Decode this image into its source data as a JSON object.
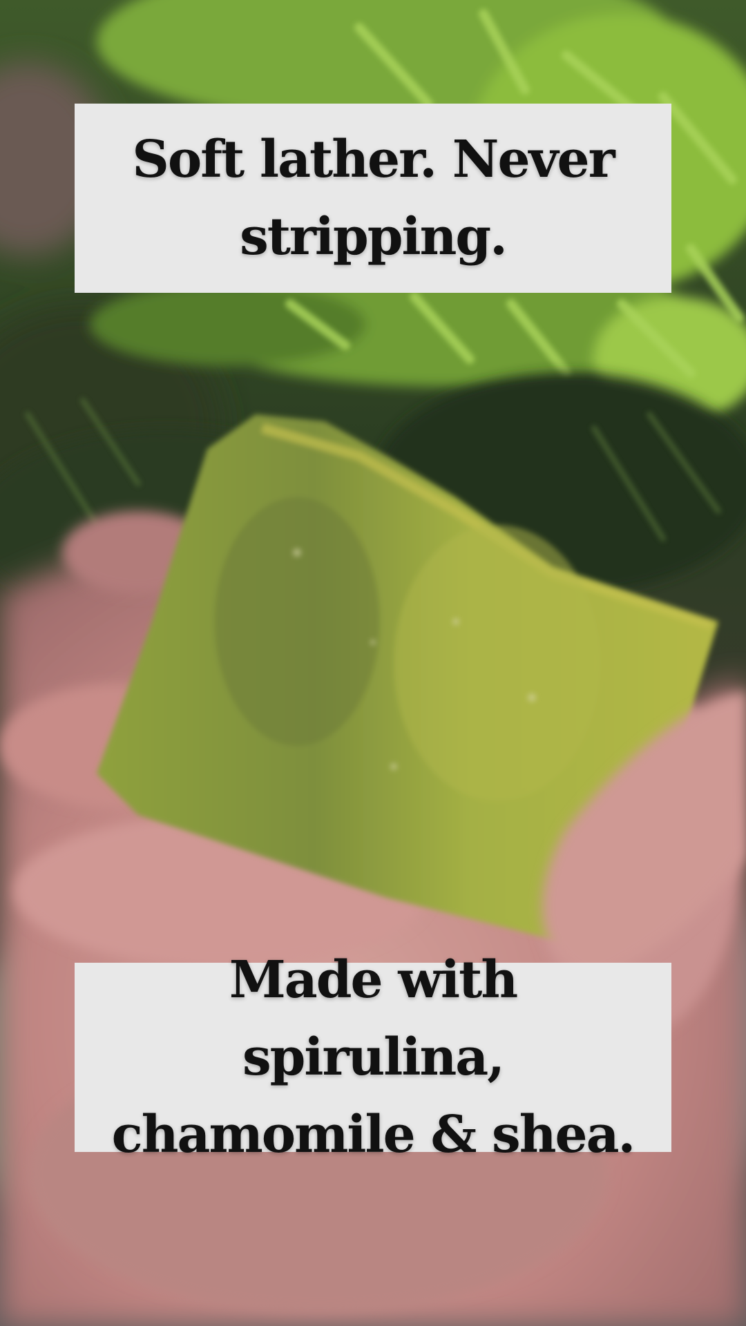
{
  "overlay": {
    "top_caption": "Soft lather. Never stripping.",
    "bottom_caption": "Made with spirulina, chamomile & shea."
  },
  "colors": {
    "caption_bg": "#e8e8e8",
    "caption_text": "#111111",
    "soap": "#9aa843",
    "foliage": "#6e9a32",
    "skin": "#c98a86"
  },
  "icons": []
}
